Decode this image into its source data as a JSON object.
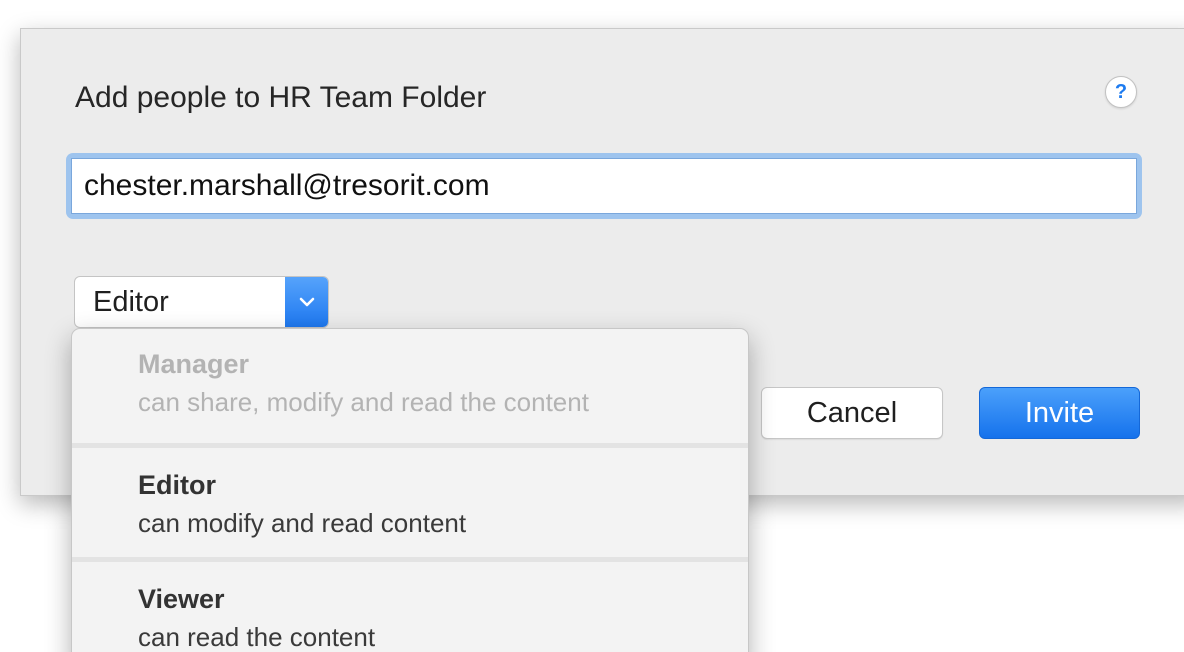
{
  "dialog": {
    "title": "Add people to HR Team Folder",
    "help_label": "?",
    "email_value": "chester.marshall@tresorit.com",
    "email_placeholder": "",
    "role_selected": "Editor",
    "cancel_label": "Cancel",
    "invite_label": "Invite"
  },
  "role_menu": {
    "options": [
      {
        "title": "Manager",
        "description": "can share, modify and read the content",
        "enabled": false
      },
      {
        "title": "Editor",
        "description": "can modify and read content",
        "enabled": true
      },
      {
        "title": "Viewer",
        "description": "can read the content",
        "enabled": true
      }
    ]
  },
  "colors": {
    "accent": "#1e78f0",
    "dialog_background": "#ececec",
    "focus_ring": "#9ec4ee",
    "disabled_text": "#b3b3b3"
  },
  "icons": {
    "help": "question-mark-icon",
    "select_arrow": "chevron-down-icon"
  }
}
